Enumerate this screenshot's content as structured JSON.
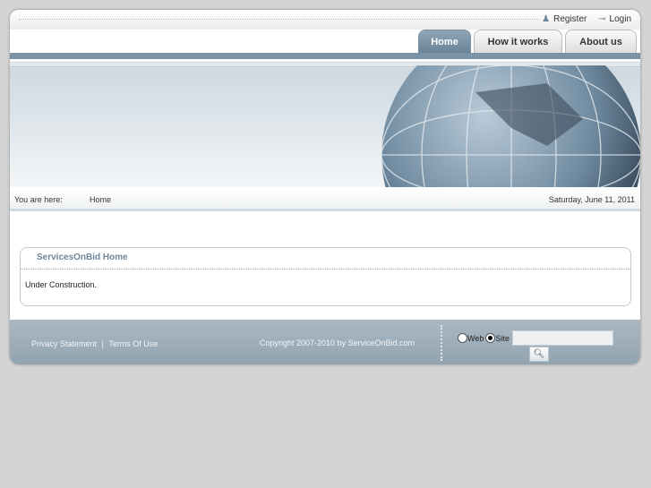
{
  "top_links": {
    "register": "Register",
    "login": "Login"
  },
  "tabs": [
    {
      "label": "Home",
      "active": true
    },
    {
      "label": "How it works"
    },
    {
      "label": "About us"
    }
  ],
  "breadcrumb": {
    "label": "You are here:",
    "current": "Home",
    "date": "Saturday, June 11, 2011"
  },
  "content": {
    "title": "ServicesOnBid Home",
    "body": "Under Construction."
  },
  "footer": {
    "privacy": "Privacy Statement",
    "separator": "|",
    "terms": "Terms Of Use",
    "copyright": "Copyright 2007-2010 by ServiceOnBid.com",
    "search": {
      "option_web": "Web",
      "option_site": "Site",
      "selected": "Site",
      "value": ""
    }
  }
}
